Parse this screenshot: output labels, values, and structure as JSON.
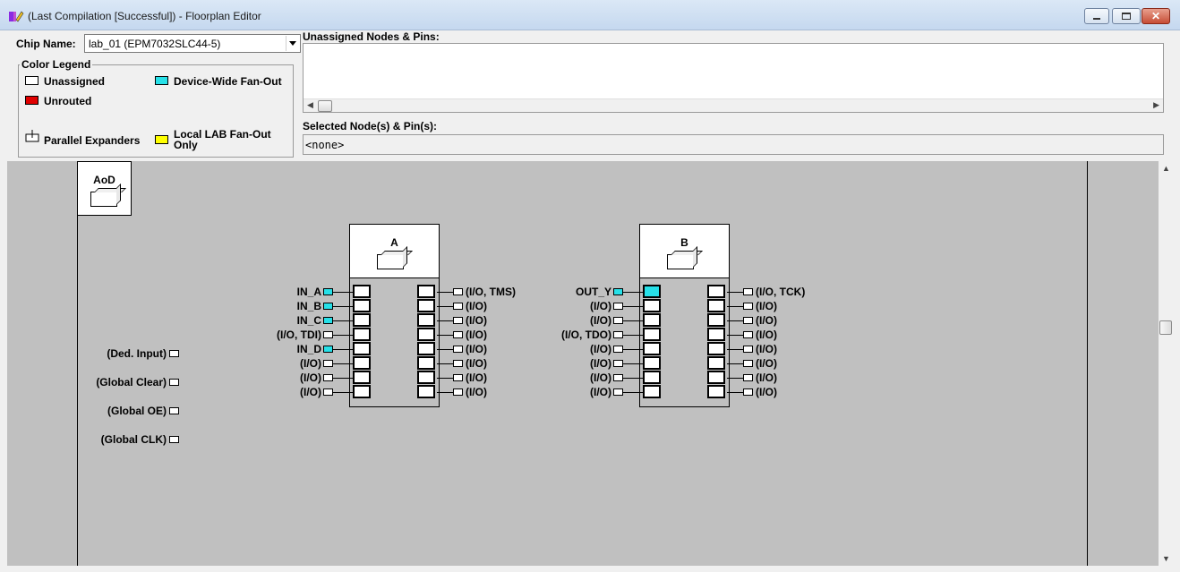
{
  "window": {
    "title": "(Last Compilation [Successful]) - Floorplan Editor"
  },
  "toolbar": {
    "chip_name_label": "Chip Name:",
    "chip_name_value": "lab_01 (EPM7032SLC44-5)",
    "unassigned_label": "Unassigned Nodes & Pins:",
    "selected_label": "Selected Node(s) & Pin(s):",
    "selected_value": "<none>"
  },
  "legend": {
    "title": "Color Legend",
    "items": [
      {
        "label": "Unassigned",
        "color": "#ffffff"
      },
      {
        "label": "Unrouted",
        "color": "#e00000"
      },
      {
        "label": "Parallel Expanders",
        "icon": "parallel-expander-icon"
      },
      {
        "label": "Device-Wide Fan-Out",
        "color": "#27e0e8"
      },
      {
        "label": "Local LAB Fan-Out Only",
        "color": "#ffff00"
      }
    ]
  },
  "canvas": {
    "aod_label": "AoD",
    "dedicated_pins": [
      "(Ded. Input)",
      "(Global Clear)",
      "(Global OE)",
      "(Global CLK)"
    ],
    "labs": [
      {
        "name": "A",
        "left_pins": [
          {
            "label": "IN_A",
            "cyan": true
          },
          {
            "label": "IN_B",
            "cyan": true
          },
          {
            "label": "IN_C",
            "cyan": true
          },
          {
            "label": "(I/O, TDI)",
            "cyan": false
          },
          {
            "label": "IN_D",
            "cyan": true
          },
          {
            "label": "(I/O)",
            "cyan": false
          },
          {
            "label": "(I/O)",
            "cyan": false
          },
          {
            "label": "(I/O)",
            "cyan": false
          }
        ],
        "right_pins": [
          "(I/O, TMS)",
          "(I/O)",
          "(I/O)",
          "(I/O)",
          "(I/O)",
          "(I/O)",
          "(I/O)",
          "(I/O)"
        ],
        "left_cells_cyan": [
          false,
          false,
          false,
          false,
          false,
          false,
          false,
          false
        ]
      },
      {
        "name": "B",
        "left_pins": [
          {
            "label": "OUT_Y",
            "cyan": true
          },
          {
            "label": "(I/O)",
            "cyan": false
          },
          {
            "label": "(I/O)",
            "cyan": false
          },
          {
            "label": "(I/O, TDO)",
            "cyan": false
          },
          {
            "label": "(I/O)",
            "cyan": false
          },
          {
            "label": "(I/O)",
            "cyan": false
          },
          {
            "label": "(I/O)",
            "cyan": false
          },
          {
            "label": "(I/O)",
            "cyan": false
          }
        ],
        "right_pins": [
          "(I/O, TCK)",
          "(I/O)",
          "(I/O)",
          "(I/O)",
          "(I/O)",
          "(I/O)",
          "(I/O)",
          "(I/O)"
        ],
        "left_cells_cyan": [
          true,
          false,
          false,
          false,
          false,
          false,
          false,
          false
        ]
      }
    ]
  }
}
